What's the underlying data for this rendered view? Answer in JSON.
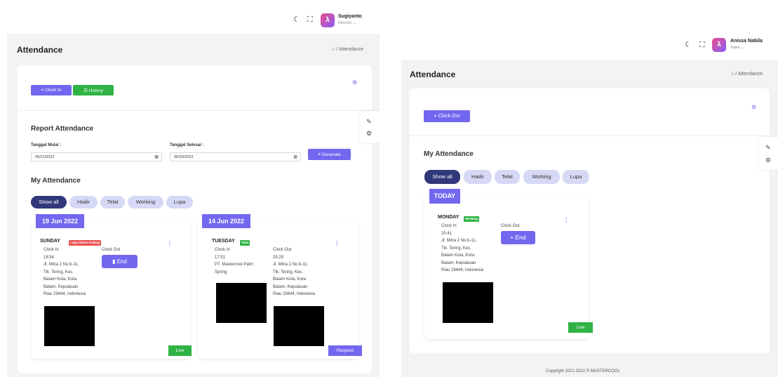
{
  "left": {
    "user": {
      "name": "Sugiyanto",
      "role": "Director ⌄"
    },
    "page_title": "Attendance",
    "breadcrumb": "/ Attendance",
    "buttons": {
      "clock_in": "Clock In",
      "history": "History"
    },
    "report": {
      "title": "Report Attendance",
      "start_label": "Tanggal Mulai :",
      "start_value": "05/21/2022",
      "end_label": "Tanggal Selesai :",
      "end_value": "06/20/2022",
      "generate": "Generate"
    },
    "my_attendance": "My Attendance",
    "filters": [
      "Show all",
      "Hadir",
      "Telat",
      "Working",
      "Lupa"
    ],
    "cards": [
      {
        "date": "19 Jun 2022",
        "day": "SUNDAY",
        "badge": "Lupa Absen Pulang",
        "badge_color": "#ea5455",
        "clock_in_label": "Clock In",
        "clock_in_time": "18:54",
        "clock_in_address": [
          "Jl. Mitra 2 No.b-11,",
          "Tlk. Tering, Kec.",
          "Batam Kota, Kota",
          "Batam, Kepulauan",
          "Riau 29444, Indonesia"
        ],
        "clock_out_label": "Clock Out",
        "end_button": "End",
        "corner_label": "Live",
        "corner_color": "#2fb344"
      },
      {
        "date": "14 Jun 2022",
        "day": "TUESDAY",
        "badge": "Telat",
        "badge_color": "#2fb344",
        "clock_in_label": "Clock In",
        "clock_in_time": "17:51",
        "clock_in_address": [
          "PT. Mastercool Palm",
          "Spring"
        ],
        "clock_out_label": "Clock Out",
        "clock_out_time": "20:29",
        "clock_out_address": [
          "Jl. Mitra 2 No.b-11,",
          "Tlk. Tering, Kec.",
          "Batam Kota, Kota",
          "Batam, Kepulauan",
          "Riau 29444, Indonesia"
        ],
        "corner_label": "Request",
        "corner_color": "#7367f0"
      }
    ]
  },
  "right": {
    "user": {
      "name": "Anissa Nabila",
      "role": "Sales ⌄"
    },
    "page_title": "Attendance",
    "breadcrumb": "/ Attendance",
    "buttons": {
      "clock_out": "Clock Out"
    },
    "my_attendance": "My Attendance",
    "filters": [
      "Show all",
      "Hadir",
      "Telat",
      "Working",
      "Lupa"
    ],
    "card": {
      "date": "TODAY",
      "day": "MONDAY",
      "badge": "Working",
      "badge_color": "#2fb344",
      "clock_in_label": "Clock In",
      "clock_in_time": "20:41",
      "clock_in_address": [
        "Jl. Mitra 2 No.b-11,",
        "Tlk. Tering, Kec.",
        "Batam Kota, Kota",
        "Batam, Kepulauan",
        "Riau 29444, Indonesia"
      ],
      "clock_out_label": "Clock Out",
      "end_button": "End",
      "corner_label": "Live",
      "corner_color": "#2fb344"
    },
    "footer": "Copyright 2021-2022 © MASTERCOOL"
  },
  "icons": {
    "moon": "☾",
    "fullscreen": "⛶",
    "home": "⌂",
    "gear": "⚙",
    "brush": "✎",
    "pin": "⌖",
    "list": "☰",
    "calendar": "▦",
    "chart": "≡",
    "dots": "⋮",
    "avatar_glyph": "λ"
  },
  "colors": {
    "accent": "#7367f0",
    "success": "#2fb344",
    "danger": "#ea5455",
    "pill_active": "#31387a",
    "pill": "#d6d9f5"
  }
}
